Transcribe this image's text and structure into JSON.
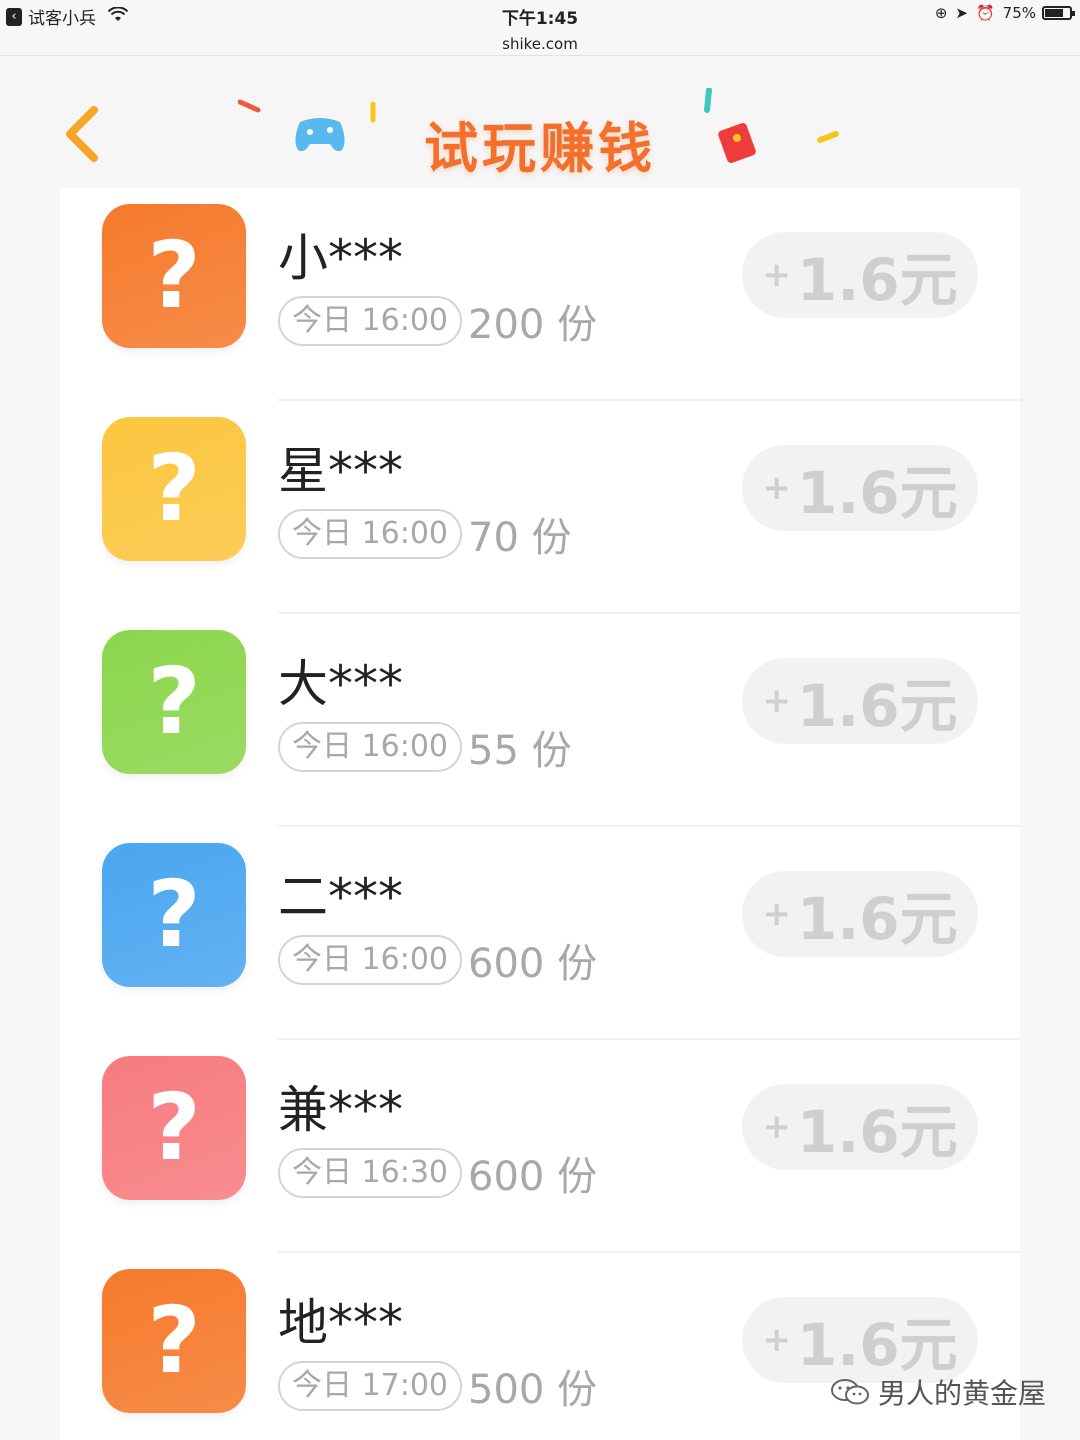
{
  "status_bar": {
    "back_app_label": "试客小兵",
    "time": "下午1:45",
    "url": "shike.com",
    "battery": "75%",
    "battery_level": 0.75
  },
  "header": {
    "title": "试玩赚钱",
    "accent_color": "#f36f2a"
  },
  "tasks": [
    {
      "name": "小***",
      "time": "今日 16:00",
      "quantity": "200 份",
      "reward_plus": "+",
      "reward": "1.6元",
      "icon_color": "#f57a2c"
    },
    {
      "name": "星***",
      "time": "今日 16:00",
      "quantity": "70 份",
      "reward_plus": "+",
      "reward": "1.6元",
      "icon_color": "#fbc53e"
    },
    {
      "name": "大***",
      "time": "今日 16:00",
      "quantity": "55 份",
      "reward_plus": "+",
      "reward": "1.6元",
      "icon_color": "#8bd64b"
    },
    {
      "name": "二***",
      "time": "今日 16:00",
      "quantity": "600 份",
      "reward_plus": "+",
      "reward": "1.6元",
      "icon_color": "#4aa6f0"
    },
    {
      "name": "兼***",
      "time": "今日 16:30",
      "quantity": "600 份",
      "reward_plus": "+",
      "reward": "1.6元",
      "icon_color": "#f77b7e"
    },
    {
      "name": "地***",
      "time": "今日 17:00",
      "quantity": "500 份",
      "reward_plus": "+",
      "reward": "1.6元",
      "icon_color": "#f57a2c"
    }
  ],
  "icons": {
    "app_icon_glyph": "?",
    "back": "chevron-left-icon"
  },
  "watermark": "男人的黄金屋"
}
